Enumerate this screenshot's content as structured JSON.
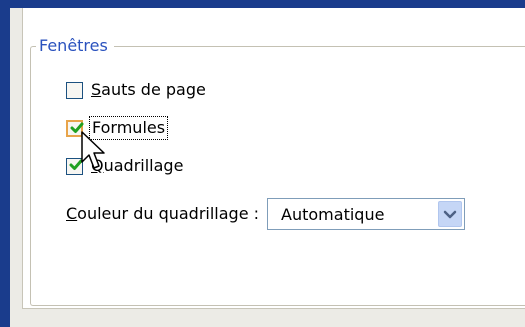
{
  "group": {
    "title": "Fenêtres"
  },
  "checkboxes": [
    {
      "label": "Sauts de page",
      "checked": false
    },
    {
      "label": "Formules",
      "checked": true,
      "focused": true
    },
    {
      "label": "Quadrillage",
      "checked": true
    }
  ],
  "gridline_color": {
    "label": "Couleur du quadrillage :",
    "value": "Automatique"
  },
  "colors": {
    "window_border": "#1a3c8c",
    "group_title": "#2a52be",
    "checkmark": "#21a121",
    "focused_checkbox_border": "#e8a44a"
  },
  "icons": {
    "cursor": "mouse-pointer-icon",
    "dropdown": "chevron-down-icon",
    "check": "checkmark-icon"
  }
}
